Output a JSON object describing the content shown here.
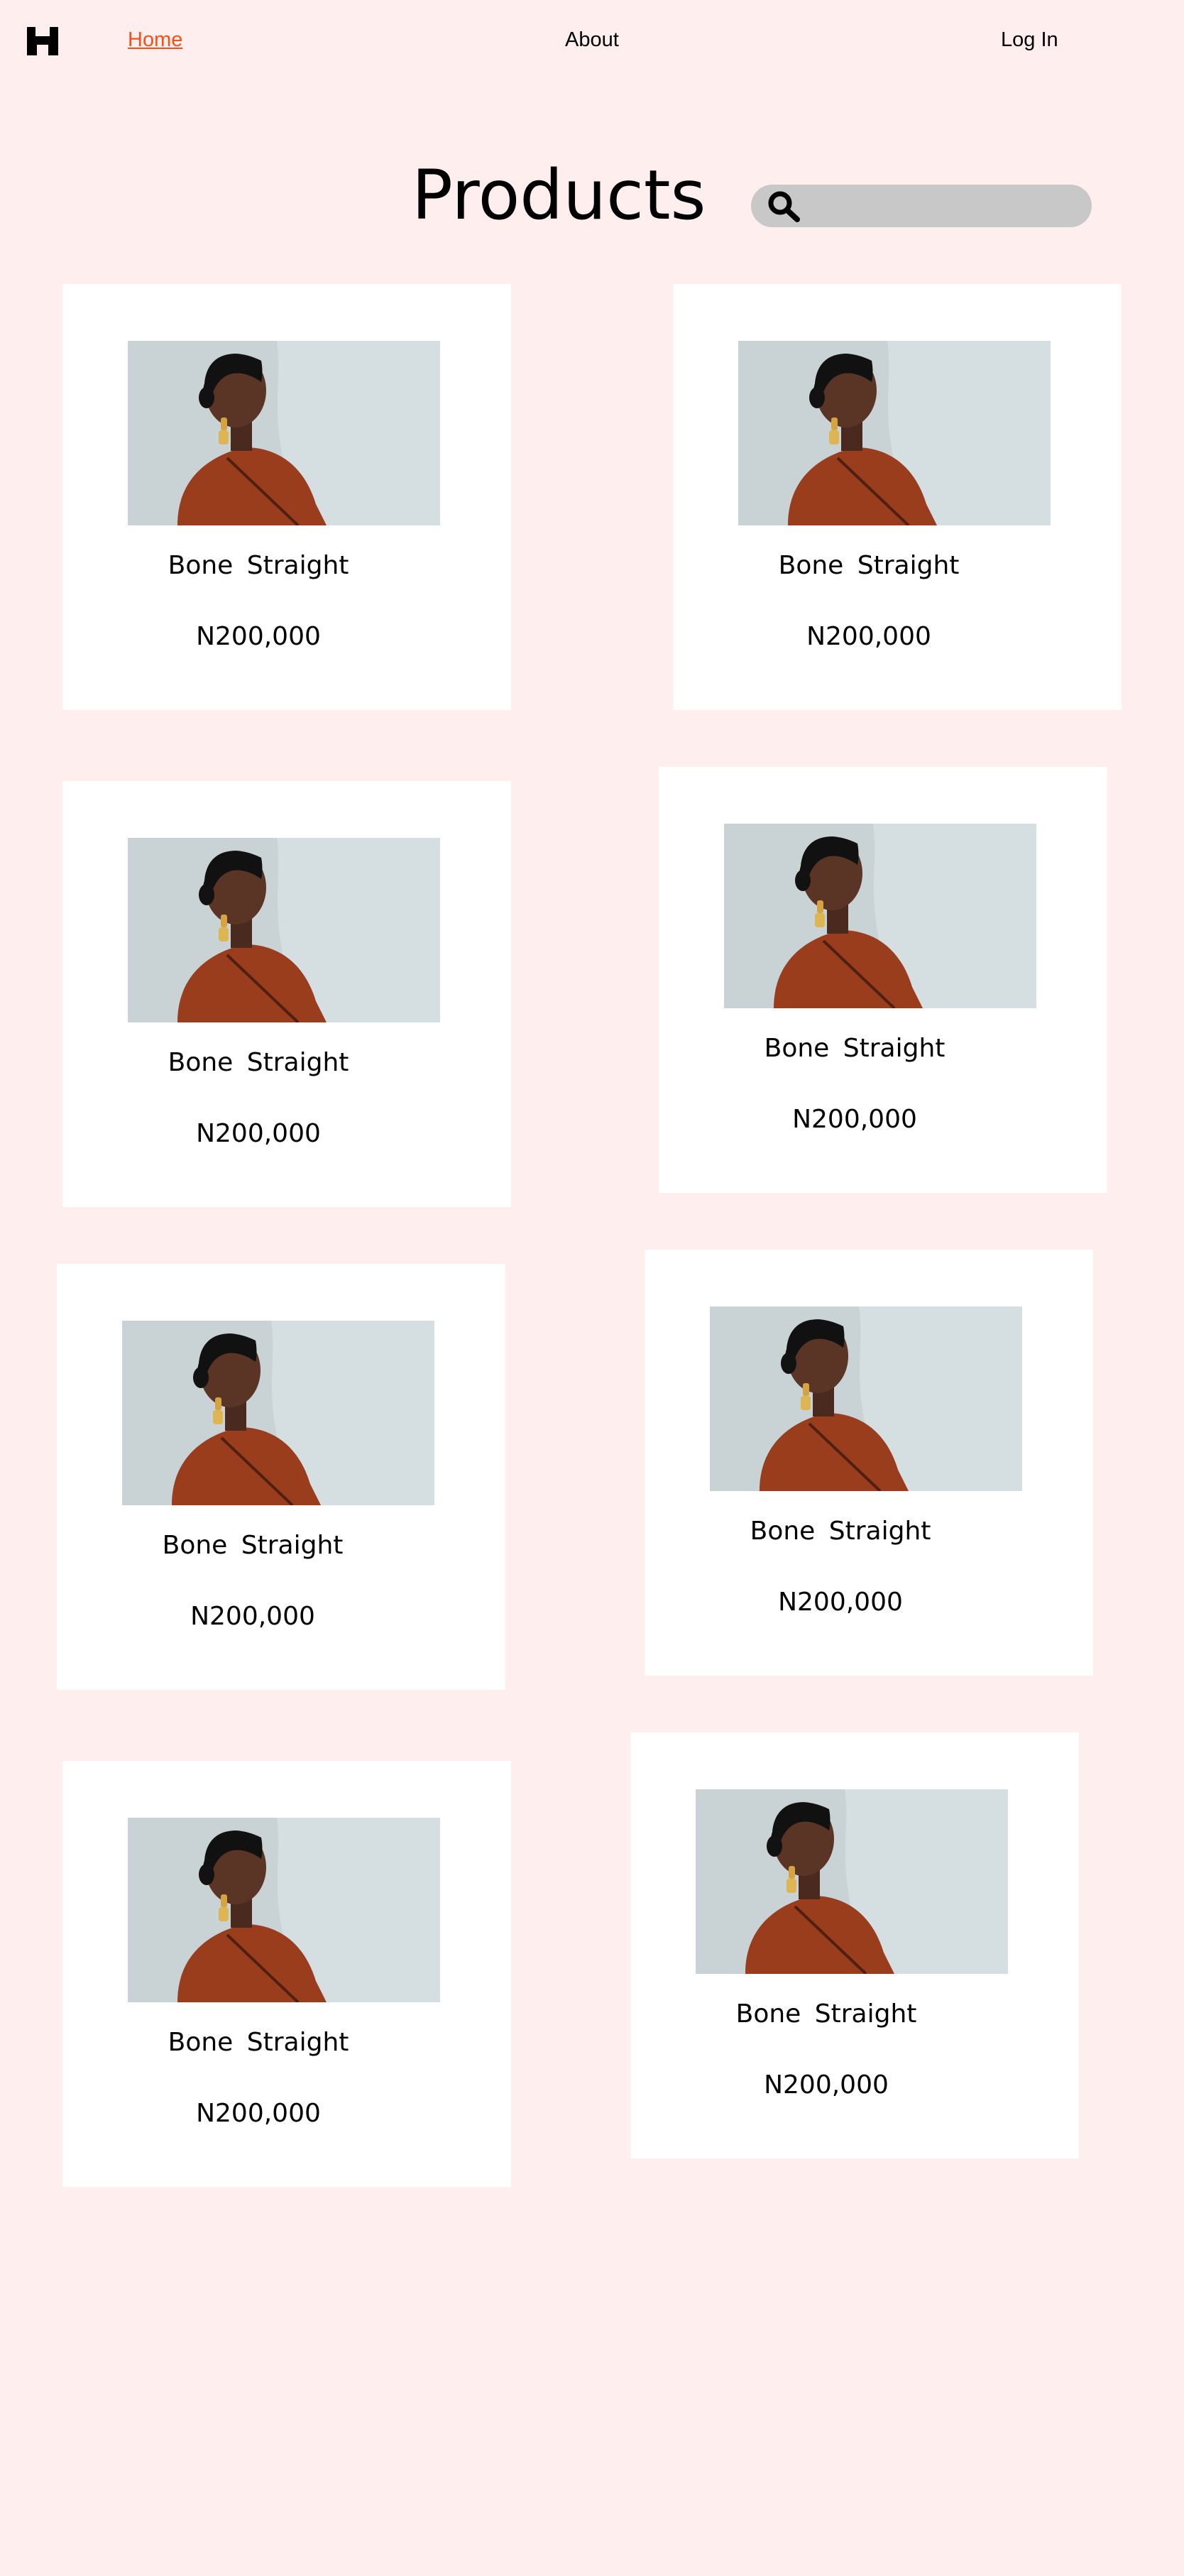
{
  "nav": {
    "logo_icon": "h-logo-icon",
    "home_label": "Home",
    "about_label": "About",
    "login_label": "Log In"
  },
  "page": {
    "title": "Products"
  },
  "search": {
    "icon": "search-icon",
    "value": ""
  },
  "products": [
    {
      "name": "Bone  Straight",
      "price": "N200,000"
    },
    {
      "name": "Bone  Straight",
      "price": "N200,000"
    },
    {
      "name": "Bone  Straight",
      "price": "N200,000"
    },
    {
      "name": "Bone  Straight",
      "price": "N200,000"
    },
    {
      "name": "Bone  Straight",
      "price": "N200,000"
    },
    {
      "name": "Bone  Straight",
      "price": "N200,000"
    },
    {
      "name": "Bone  Straight",
      "price": "N200,000"
    },
    {
      "name": "Bone  Straight",
      "price": "N200,000"
    }
  ],
  "colors": {
    "page_background": "#FFEEEE",
    "card_background": "#FFFFFF",
    "active_link": "#F2511B",
    "search_background": "#C8C8C8"
  }
}
